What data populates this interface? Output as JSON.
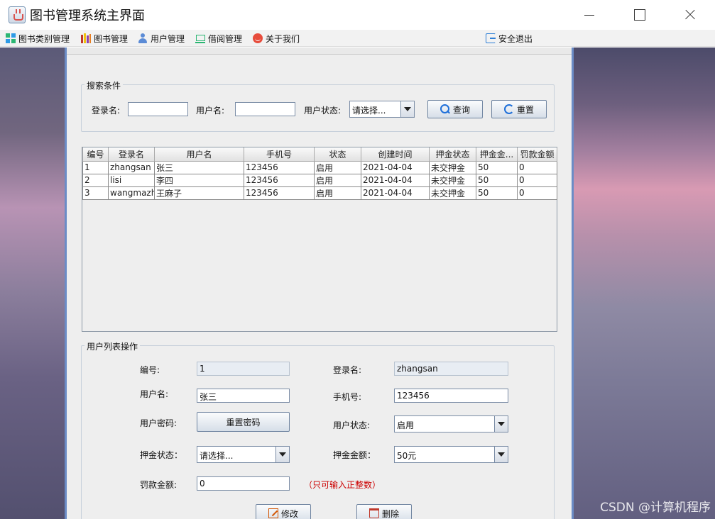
{
  "window": {
    "title": "图书管理系统主界面"
  },
  "menu": {
    "items": [
      {
        "label": "图书类别管理",
        "icon": "category-grid-icon"
      },
      {
        "label": "图书管理",
        "icon": "books-icon"
      },
      {
        "label": "用户管理",
        "icon": "user-icon"
      },
      {
        "label": "借阅管理",
        "icon": "cart-icon"
      },
      {
        "label": "关于我们",
        "icon": "smile-icon"
      },
      {
        "label": "安全退出",
        "icon": "exit-icon"
      }
    ]
  },
  "search": {
    "legend": "搜索条件",
    "login_label": "登录名:",
    "login_value": "",
    "username_label": "用户名:",
    "username_value": "",
    "status_label": "用户状态:",
    "status_value": "请选择...",
    "query_button": "查询",
    "reset_button": "重置"
  },
  "table": {
    "columns": [
      "编号",
      "登录名",
      "用户名",
      "手机号",
      "状态",
      "创建时间",
      "押金状态",
      "押金金...",
      "罚款金额"
    ],
    "rows": [
      [
        "1",
        "zhangsan",
        "张三",
        "123456",
        "启用",
        "2021-04-04",
        "未交押金",
        "50",
        "0"
      ],
      [
        "2",
        "lisi",
        "李四",
        "123456",
        "启用",
        "2021-04-04",
        "未交押金",
        "50",
        "0"
      ],
      [
        "3",
        "wangmazhi",
        "王麻子",
        "123456",
        "启用",
        "2021-04-04",
        "未交押金",
        "50",
        "0"
      ]
    ]
  },
  "form": {
    "legend": "用户列表操作",
    "id_label": "编号:",
    "id_value": "1",
    "login_label": "登录名:",
    "login_value": "zhangsan",
    "username_label": "用户名:",
    "username_value": "张三",
    "phone_label": "手机号:",
    "phone_value": "123456",
    "password_label": "用户密码:",
    "reset_password_button": "重置密码",
    "status_label": "用户状态:",
    "status_value": "启用",
    "deposit_status_label": "押金状态：",
    "deposit_status_value": "请选择...",
    "deposit_amount_label": "押金金额：",
    "deposit_amount_value": "50元",
    "fine_label": "罚款金额:",
    "fine_value": "0",
    "fine_hint": "（只可输入正整数）",
    "edit_button": "修改",
    "delete_button": "删除"
  },
  "watermark": "CSDN @计算机程序"
}
